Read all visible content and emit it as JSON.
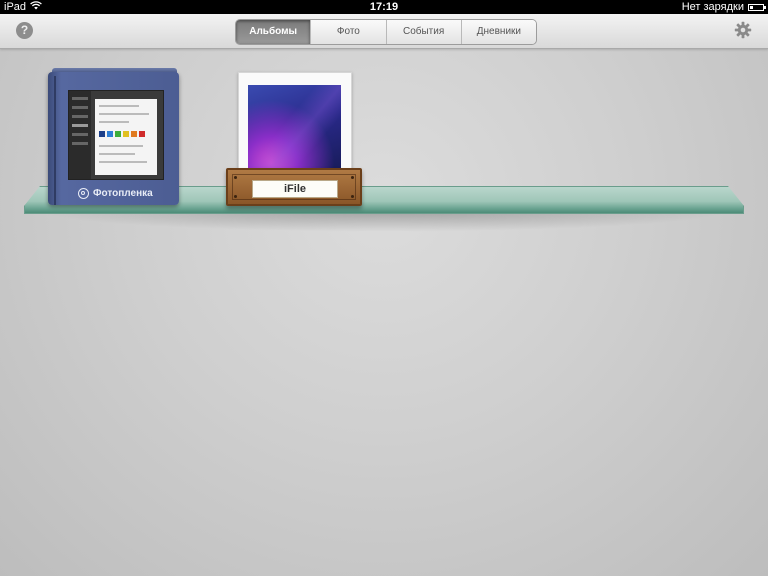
{
  "status_bar": {
    "device": "iPad",
    "time": "17:19",
    "battery_text": "Нет зарядки"
  },
  "toolbar": {
    "help_label": "?",
    "tabs": [
      {
        "label": "Альбомы",
        "active": true
      },
      {
        "label": "Фото",
        "active": false
      },
      {
        "label": "События",
        "active": false
      },
      {
        "label": "Дневники",
        "active": false
      }
    ]
  },
  "albums": [
    {
      "label": "Фотопленка",
      "style": "book",
      "icon": "camera-icon"
    },
    {
      "label": "iFile",
      "style": "crate"
    }
  ],
  "colors": {
    "status_bar_bg": "#000000",
    "active_tab": "#8a8a8a",
    "shelf_glass": "#9fc6b8",
    "book_cover": "#4c5d93",
    "crate_wood": "#9b6536"
  },
  "icons": [
    "wifi-icon",
    "battery-icon",
    "help-icon",
    "gear-icon",
    "camera-icon"
  ]
}
